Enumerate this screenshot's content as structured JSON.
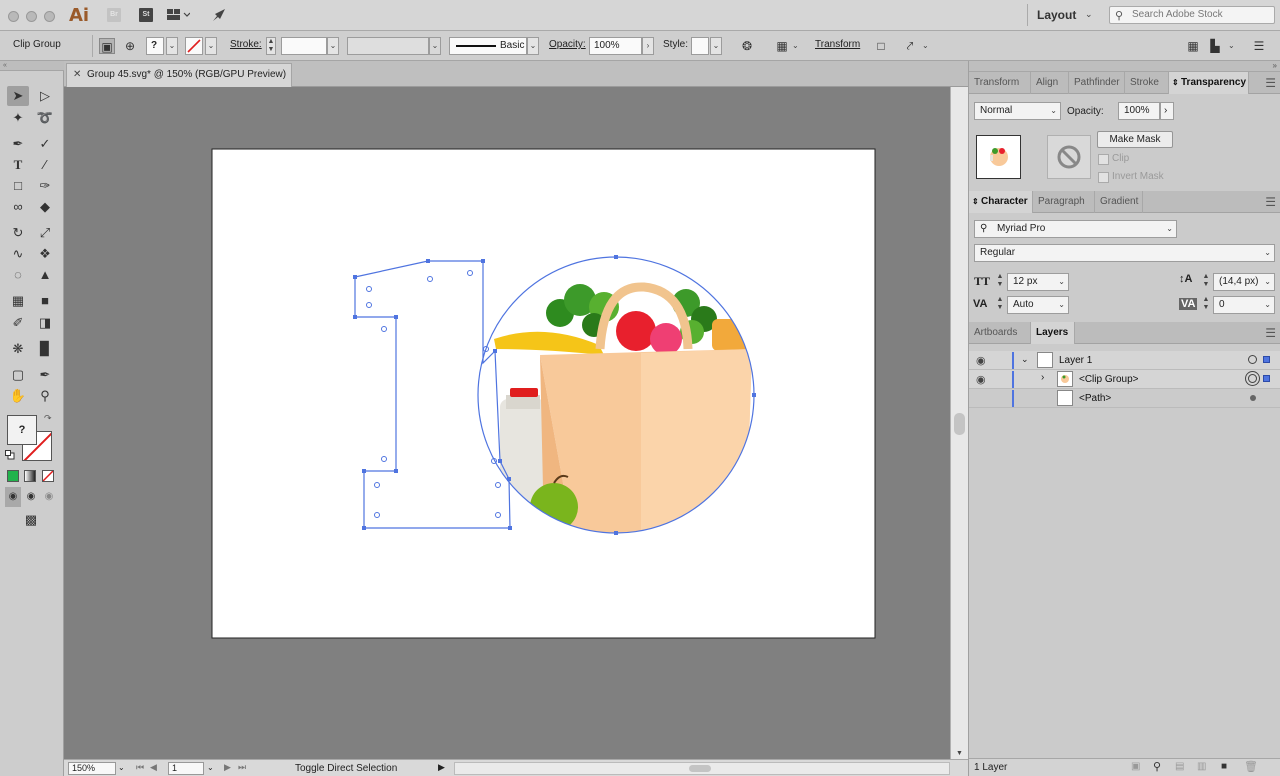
{
  "appbar": {
    "ai_logo": "Ai",
    "br_label": "Br",
    "st_label": "St",
    "workspace": "Layout",
    "stock_search_placeholder": "Search Adobe Stock"
  },
  "controlbar": {
    "selection_type": "Clip Group",
    "fill_unknown": "?",
    "stroke_label": "Stroke:",
    "brush_profile": "Basic",
    "opacity_label": "Opacity:",
    "opacity_value": "100%",
    "style_label": "Style:",
    "transform_label": "Transform"
  },
  "document": {
    "tab_title": "Group 45.svg* @ 150% (RGB/GPU Preview)"
  },
  "statusbar": {
    "zoom": "150%",
    "artboard_number": "1",
    "status_text": "Toggle Direct Selection"
  },
  "tools": {
    "fill_unknown": "?"
  },
  "transparency_panel": {
    "tabs": [
      "Transform",
      "Align",
      "Pathfinder",
      "Stroke",
      "Transparency"
    ],
    "blend_mode": "Normal",
    "opacity_label": "Opacity:",
    "opacity_value": "100%",
    "make_mask_label": "Make Mask",
    "clip_label": "Clip",
    "invert_mask_label": "Invert Mask"
  },
  "character_panel": {
    "tabs": [
      "Character",
      "Paragraph",
      "Gradient"
    ],
    "font_family": "Myriad Pro",
    "font_style": "Regular",
    "font_size": "12 px",
    "leading": "(14,4 px)",
    "kerning": "Auto",
    "tracking": "0"
  },
  "layers_panel": {
    "tabs": [
      "Artboards",
      "Layers"
    ],
    "rows": [
      {
        "name": "Layer 1"
      },
      {
        "name": "<Clip Group>"
      },
      {
        "name": "<Path>"
      }
    ],
    "layer_count": "1 Layer"
  },
  "colors": {
    "selection_blue": "#4f74e0",
    "bag": "#f8c99a",
    "apple_red": "#e8202d",
    "banana": "#f5c518",
    "apple_green": "#7ab51d",
    "broccoli": "#3d9a2a"
  }
}
